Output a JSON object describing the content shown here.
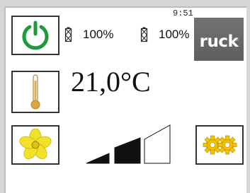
{
  "status": {
    "time": "9:51",
    "battery_1": "100%",
    "battery_2": "100%"
  },
  "brand": {
    "name": "ruck",
    "trademark": "™"
  },
  "climate": {
    "temperature": "21,0°C"
  },
  "fan": {
    "level": 2,
    "max_level": 3
  },
  "icons": {
    "power": "power-icon",
    "battery": "battery-icon",
    "thermometer": "thermometer-icon",
    "fan": "fan-icon",
    "settings": "gears-icon"
  },
  "colors": {
    "power_green": "#1f9a3c",
    "fan_yellow": "#f2e12a",
    "gear_yellow": "#f4c400",
    "logo_gray": "#6a6a6a"
  }
}
